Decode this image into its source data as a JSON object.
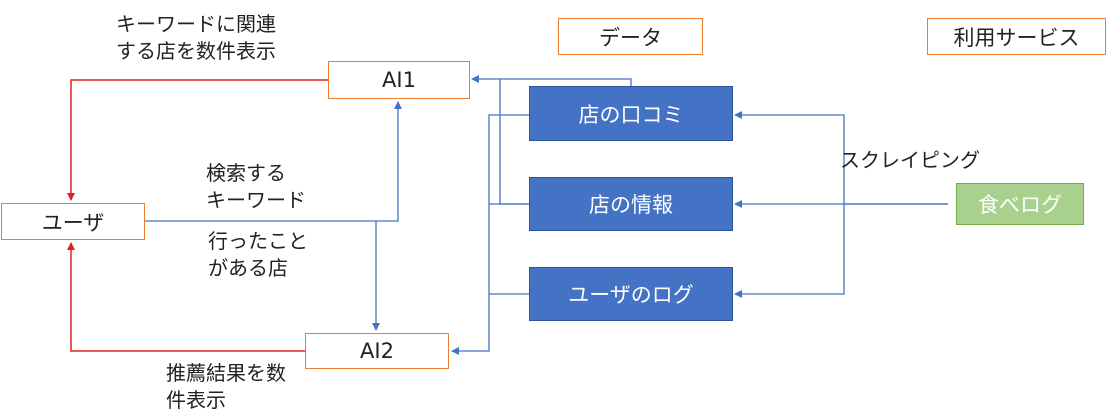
{
  "legend": {
    "data": "データ",
    "service": "利用サービス"
  },
  "nodes": {
    "ai1": "AI1",
    "ai2": "AI2",
    "user": "ユーザ",
    "reviews": "店の口コミ",
    "info": "店の情報",
    "user_log": "ユーザのログ",
    "tabelog": "食べログ"
  },
  "labels": {
    "ai1_output": [
      "キーワードに関連",
      "する店を数件表示"
    ],
    "keyword": [
      "検索する",
      "キーワード"
    ],
    "visited": [
      "行ったこと",
      "がある店"
    ],
    "ai2_output": [
      "推薦結果を数",
      "件表示"
    ],
    "scraping": "スクレイピング"
  },
  "colors": {
    "accent": "#ed7d31",
    "data_box": "#4472c4",
    "service_box": "#a9d18e",
    "arrow_blue": "#4472c4",
    "arrow_red": "#e02020"
  }
}
